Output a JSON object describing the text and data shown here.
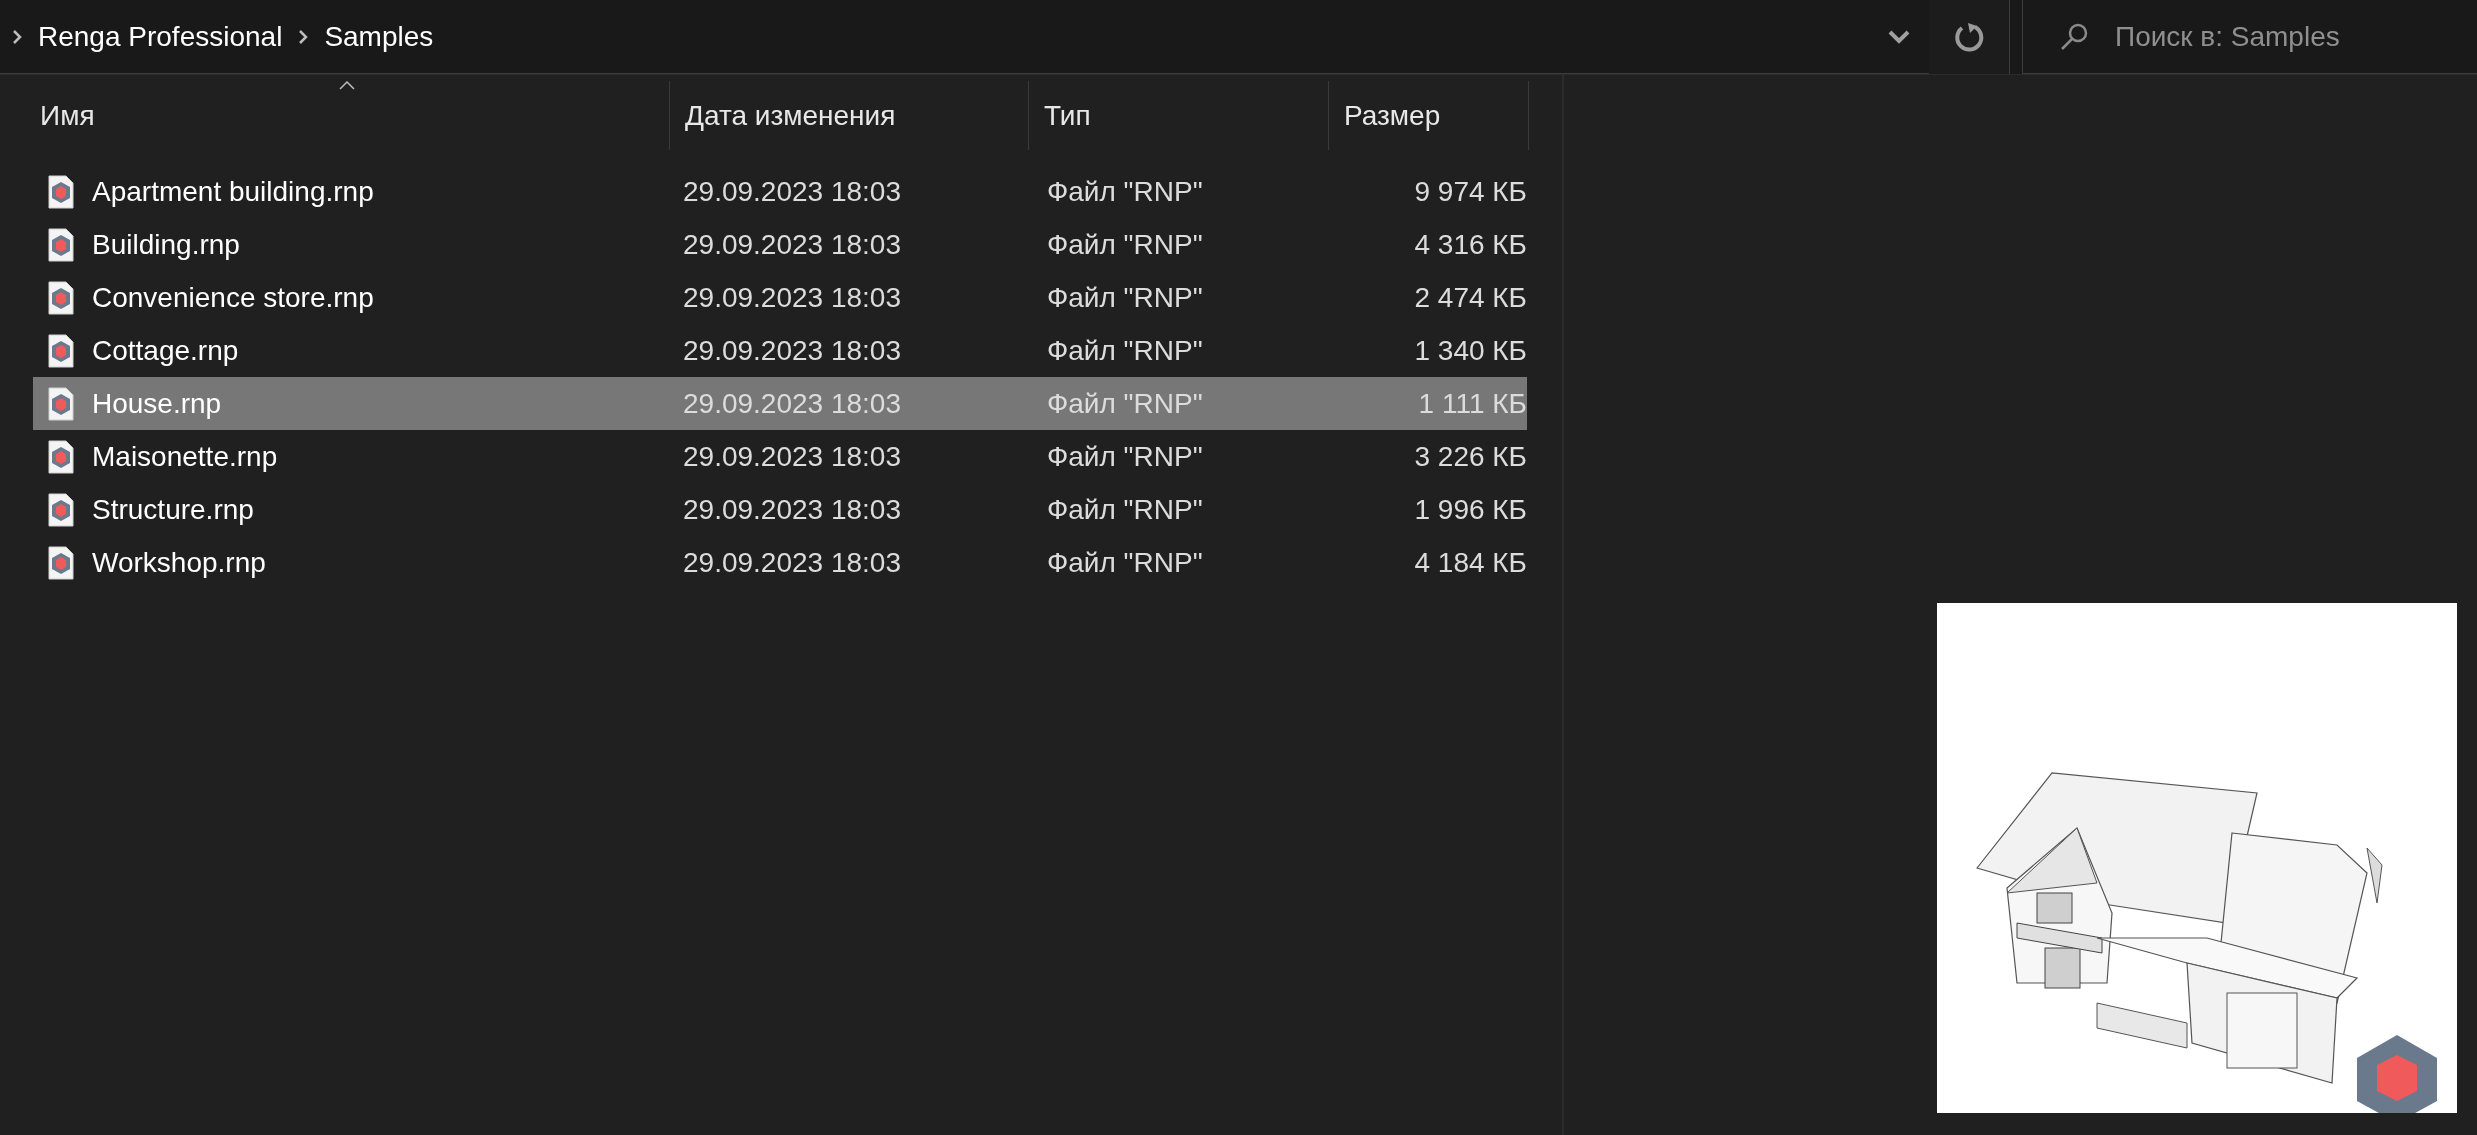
{
  "breadcrumb": [
    "Renga Professional",
    "Samples"
  ],
  "search": {
    "placeholder": "Поиск в: Samples"
  },
  "columns": [
    {
      "label": "Имя",
      "sorted": true
    },
    {
      "label": "Дата изменения",
      "sorted": false
    },
    {
      "label": "Тип",
      "sorted": false
    },
    {
      "label": "Размер",
      "sorted": false
    }
  ],
  "rows": [
    {
      "name": "Apartment building.rnp",
      "date": "29.09.2023 18:03",
      "type": "Файл \"RNP\"",
      "size": "9 974 КБ",
      "selected": false
    },
    {
      "name": "Building.rnp",
      "date": "29.09.2023 18:03",
      "type": "Файл \"RNP\"",
      "size": "4 316 КБ",
      "selected": false
    },
    {
      "name": "Convenience store.rnp",
      "date": "29.09.2023 18:03",
      "type": "Файл \"RNP\"",
      "size": "2 474 КБ",
      "selected": false
    },
    {
      "name": "Cottage.rnp",
      "date": "29.09.2023 18:03",
      "type": "Файл \"RNP\"",
      "size": "1 340 КБ",
      "selected": false
    },
    {
      "name": "House.rnp",
      "date": "29.09.2023 18:03",
      "type": "Файл \"RNP\"",
      "size": "1 111 КБ",
      "selected": true
    },
    {
      "name": "Maisonette.rnp",
      "date": "29.09.2023 18:03",
      "type": "Файл \"RNP\"",
      "size": "3 226 КБ",
      "selected": false
    },
    {
      "name": "Structure.rnp",
      "date": "29.09.2023 18:03",
      "type": "Файл \"RNP\"",
      "size": "1 996 КБ",
      "selected": false
    },
    {
      "name": "Workshop.rnp",
      "date": "29.09.2023 18:03",
      "type": "Файл \"RNP\"",
      "size": "4 184 КБ",
      "selected": false
    }
  ]
}
